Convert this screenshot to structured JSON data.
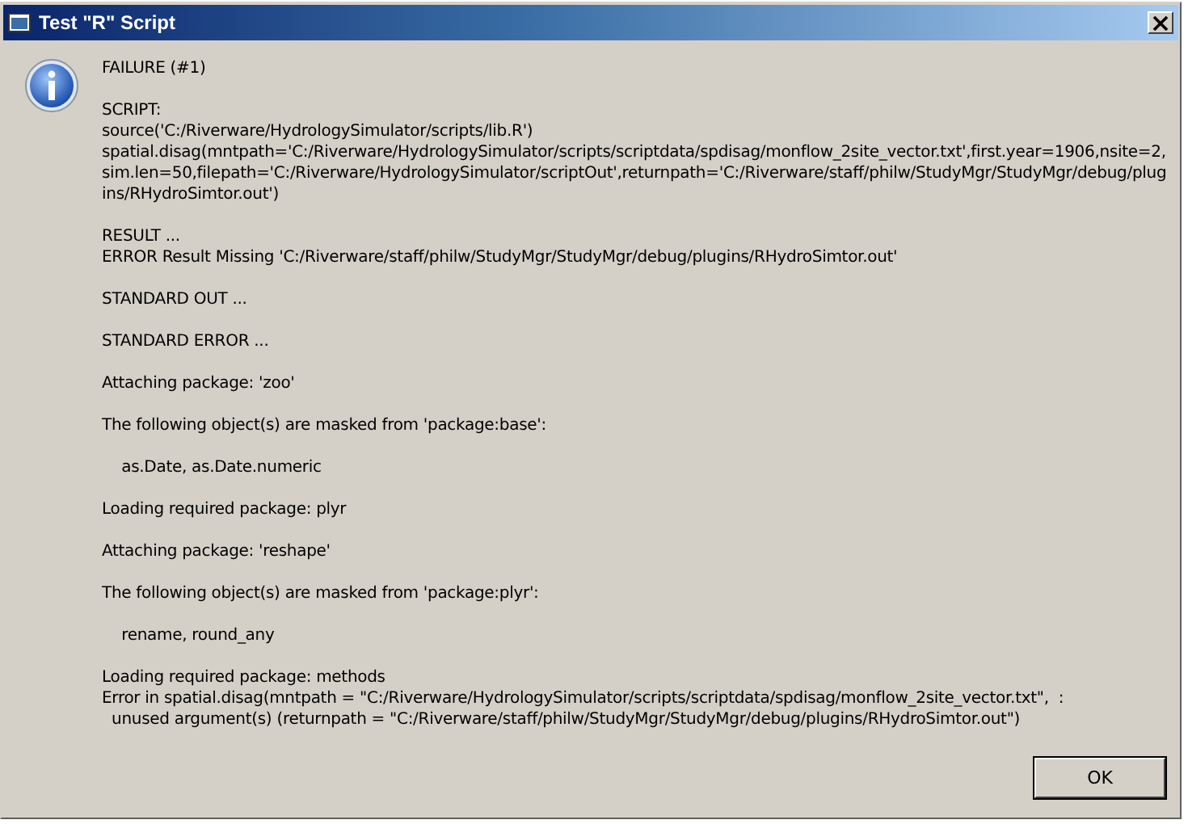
{
  "window": {
    "title": "Test \"R\" Script"
  },
  "message": [
    [
      "FAILURE (#1)"
    ],
    [
      "SCRIPT:",
      "source('C:/Riverware/HydrologySimulator/scripts/lib.R')",
      "spatial.disag(mntpath='C:/Riverware/HydrologySimulator/scripts/scriptdata/spdisag/monflow_2site_vector.txt',first.year=1906,nsite=2,",
      "sim.len=50,filepath='C:/Riverware/HydrologySimulator/scriptOut',returnpath='C:/Riverware/staff/philw/StudyMgr/StudyMgr/debug/plug",
      "ins/RHydroSimtor.out')"
    ],
    [
      "RESULT ...",
      "ERROR Result Missing 'C:/Riverware/staff/philw/StudyMgr/StudyMgr/debug/plugins/RHydroSimtor.out'"
    ],
    [
      "STANDARD OUT ..."
    ],
    [
      "STANDARD ERROR ..."
    ],
    [
      "Attaching package: 'zoo'"
    ],
    [
      "The following object(s) are masked from 'package:base':"
    ],
    [
      "    as.Date, as.Date.numeric"
    ],
    [
      "Loading required package: plyr"
    ],
    [
      "Attaching package: 'reshape'"
    ],
    [
      "The following object(s) are masked from 'package:plyr':"
    ],
    [
      "    rename, round_any"
    ],
    [
      "Loading required package: methods",
      "Error in spatial.disag(mntpath = \"C:/Riverware/HydrologySimulator/scripts/scriptdata/spdisag/monflow_2site_vector.txt\",  : ",
      "  unused argument(s) (returnpath = \"C:/Riverware/staff/philw/StudyMgr/StudyMgr/debug/plugins/RHydroSimtor.out\")"
    ]
  ],
  "buttons": [
    "OK"
  ]
}
